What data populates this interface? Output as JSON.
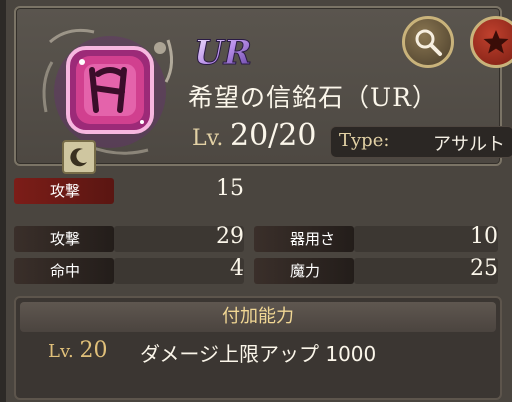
{
  "header": {
    "rarity": "UR",
    "name": "希望の信銘石（UR）",
    "level_label": "Lv.",
    "level_value": "20/20",
    "type_label": "Type:",
    "type_value": "アサルト"
  },
  "stats_single": [
    {
      "label": "攻撃",
      "value": "15"
    }
  ],
  "stats_grid": [
    {
      "label": "攻撃",
      "value": "29"
    },
    {
      "label": "器用さ",
      "value": "10"
    },
    {
      "label": "命中",
      "value": "4"
    },
    {
      "label": "魔力",
      "value": "25"
    }
  ],
  "ability": {
    "title": "付加能力",
    "level_label": "Lv.",
    "level_value": "20",
    "description": "ダメージ上限アップ 1000"
  },
  "icons": {
    "search": "magnifier-icon",
    "favorite": "star-icon",
    "crescent": "crescent-icon",
    "gem": "pink-rune-gem-icon"
  },
  "colors": {
    "accent_gold": "#e2d1a5",
    "stat_red": "#7c1d18",
    "stat_dark": "#3a2f2a",
    "gem_pink": "#d1408f"
  }
}
